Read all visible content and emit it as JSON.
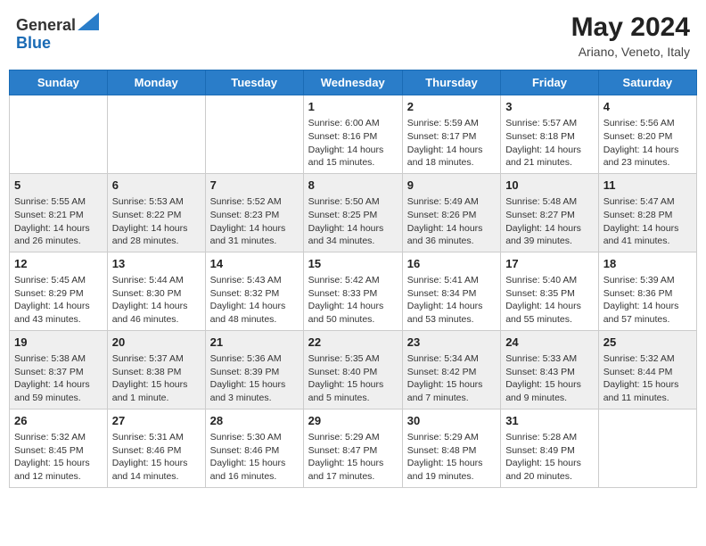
{
  "header": {
    "logo_line1": "General",
    "logo_line2": "Blue",
    "month_year": "May 2024",
    "location": "Ariano, Veneto, Italy"
  },
  "weekdays": [
    "Sunday",
    "Monday",
    "Tuesday",
    "Wednesday",
    "Thursday",
    "Friday",
    "Saturday"
  ],
  "weeks": [
    [
      null,
      null,
      null,
      {
        "day": "1",
        "sunrise": "Sunrise: 6:00 AM",
        "sunset": "Sunset: 8:16 PM",
        "daylight": "Daylight: 14 hours and 15 minutes."
      },
      {
        "day": "2",
        "sunrise": "Sunrise: 5:59 AM",
        "sunset": "Sunset: 8:17 PM",
        "daylight": "Daylight: 14 hours and 18 minutes."
      },
      {
        "day": "3",
        "sunrise": "Sunrise: 5:57 AM",
        "sunset": "Sunset: 8:18 PM",
        "daylight": "Daylight: 14 hours and 21 minutes."
      },
      {
        "day": "4",
        "sunrise": "Sunrise: 5:56 AM",
        "sunset": "Sunset: 8:20 PM",
        "daylight": "Daylight: 14 hours and 23 minutes."
      }
    ],
    [
      {
        "day": "5",
        "sunrise": "Sunrise: 5:55 AM",
        "sunset": "Sunset: 8:21 PM",
        "daylight": "Daylight: 14 hours and 26 minutes."
      },
      {
        "day": "6",
        "sunrise": "Sunrise: 5:53 AM",
        "sunset": "Sunset: 8:22 PM",
        "daylight": "Daylight: 14 hours and 28 minutes."
      },
      {
        "day": "7",
        "sunrise": "Sunrise: 5:52 AM",
        "sunset": "Sunset: 8:23 PM",
        "daylight": "Daylight: 14 hours and 31 minutes."
      },
      {
        "day": "8",
        "sunrise": "Sunrise: 5:50 AM",
        "sunset": "Sunset: 8:25 PM",
        "daylight": "Daylight: 14 hours and 34 minutes."
      },
      {
        "day": "9",
        "sunrise": "Sunrise: 5:49 AM",
        "sunset": "Sunset: 8:26 PM",
        "daylight": "Daylight: 14 hours and 36 minutes."
      },
      {
        "day": "10",
        "sunrise": "Sunrise: 5:48 AM",
        "sunset": "Sunset: 8:27 PM",
        "daylight": "Daylight: 14 hours and 39 minutes."
      },
      {
        "day": "11",
        "sunrise": "Sunrise: 5:47 AM",
        "sunset": "Sunset: 8:28 PM",
        "daylight": "Daylight: 14 hours and 41 minutes."
      }
    ],
    [
      {
        "day": "12",
        "sunrise": "Sunrise: 5:45 AM",
        "sunset": "Sunset: 8:29 PM",
        "daylight": "Daylight: 14 hours and 43 minutes."
      },
      {
        "day": "13",
        "sunrise": "Sunrise: 5:44 AM",
        "sunset": "Sunset: 8:30 PM",
        "daylight": "Daylight: 14 hours and 46 minutes."
      },
      {
        "day": "14",
        "sunrise": "Sunrise: 5:43 AM",
        "sunset": "Sunset: 8:32 PM",
        "daylight": "Daylight: 14 hours and 48 minutes."
      },
      {
        "day": "15",
        "sunrise": "Sunrise: 5:42 AM",
        "sunset": "Sunset: 8:33 PM",
        "daylight": "Daylight: 14 hours and 50 minutes."
      },
      {
        "day": "16",
        "sunrise": "Sunrise: 5:41 AM",
        "sunset": "Sunset: 8:34 PM",
        "daylight": "Daylight: 14 hours and 53 minutes."
      },
      {
        "day": "17",
        "sunrise": "Sunrise: 5:40 AM",
        "sunset": "Sunset: 8:35 PM",
        "daylight": "Daylight: 14 hours and 55 minutes."
      },
      {
        "day": "18",
        "sunrise": "Sunrise: 5:39 AM",
        "sunset": "Sunset: 8:36 PM",
        "daylight": "Daylight: 14 hours and 57 minutes."
      }
    ],
    [
      {
        "day": "19",
        "sunrise": "Sunrise: 5:38 AM",
        "sunset": "Sunset: 8:37 PM",
        "daylight": "Daylight: 14 hours and 59 minutes."
      },
      {
        "day": "20",
        "sunrise": "Sunrise: 5:37 AM",
        "sunset": "Sunset: 8:38 PM",
        "daylight": "Daylight: 15 hours and 1 minute."
      },
      {
        "day": "21",
        "sunrise": "Sunrise: 5:36 AM",
        "sunset": "Sunset: 8:39 PM",
        "daylight": "Daylight: 15 hours and 3 minutes."
      },
      {
        "day": "22",
        "sunrise": "Sunrise: 5:35 AM",
        "sunset": "Sunset: 8:40 PM",
        "daylight": "Daylight: 15 hours and 5 minutes."
      },
      {
        "day": "23",
        "sunrise": "Sunrise: 5:34 AM",
        "sunset": "Sunset: 8:42 PM",
        "daylight": "Daylight: 15 hours and 7 minutes."
      },
      {
        "day": "24",
        "sunrise": "Sunrise: 5:33 AM",
        "sunset": "Sunset: 8:43 PM",
        "daylight": "Daylight: 15 hours and 9 minutes."
      },
      {
        "day": "25",
        "sunrise": "Sunrise: 5:32 AM",
        "sunset": "Sunset: 8:44 PM",
        "daylight": "Daylight: 15 hours and 11 minutes."
      }
    ],
    [
      {
        "day": "26",
        "sunrise": "Sunrise: 5:32 AM",
        "sunset": "Sunset: 8:45 PM",
        "daylight": "Daylight: 15 hours and 12 minutes."
      },
      {
        "day": "27",
        "sunrise": "Sunrise: 5:31 AM",
        "sunset": "Sunset: 8:46 PM",
        "daylight": "Daylight: 15 hours and 14 minutes."
      },
      {
        "day": "28",
        "sunrise": "Sunrise: 5:30 AM",
        "sunset": "Sunset: 8:46 PM",
        "daylight": "Daylight: 15 hours and 16 minutes."
      },
      {
        "day": "29",
        "sunrise": "Sunrise: 5:29 AM",
        "sunset": "Sunset: 8:47 PM",
        "daylight": "Daylight: 15 hours and 17 minutes."
      },
      {
        "day": "30",
        "sunrise": "Sunrise: 5:29 AM",
        "sunset": "Sunset: 8:48 PM",
        "daylight": "Daylight: 15 hours and 19 minutes."
      },
      {
        "day": "31",
        "sunrise": "Sunrise: 5:28 AM",
        "sunset": "Sunset: 8:49 PM",
        "daylight": "Daylight: 15 hours and 20 minutes."
      },
      null
    ]
  ]
}
